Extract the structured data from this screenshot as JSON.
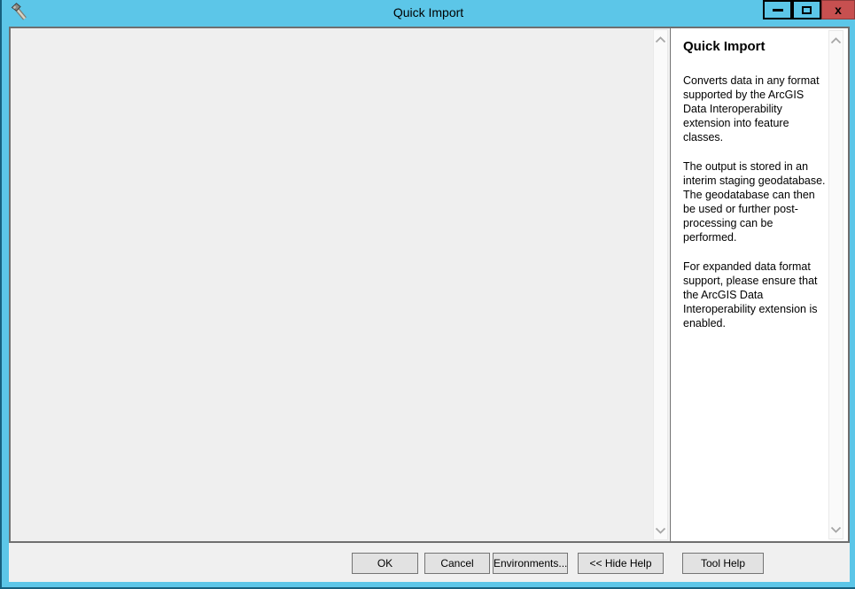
{
  "window": {
    "title": "Quick Import",
    "close_glyph": "x"
  },
  "help": {
    "heading": "Quick Import",
    "paragraphs": [
      "Converts data in any format supported by the ArcGIS Data Interoperability extension into feature classes.",
      "The output is stored in an interim staging geodatabase. The geodatabase can then be used or further post-processing can be performed.",
      "For expanded data format support, please ensure that the ArcGIS Data Interoperability extension is enabled."
    ]
  },
  "footer": {
    "buttons": [
      {
        "label": "OK"
      },
      {
        "label": "Cancel"
      },
      {
        "label": "Environments..."
      },
      {
        "label": "<< Hide Help"
      },
      {
        "label": "Tool Help"
      }
    ]
  },
  "colors": {
    "titlebar_blue": "#5cc6e8",
    "close_red": "#c75050",
    "panel_gray": "#efefef",
    "help_white": "#ffffff",
    "border_gray": "#6f6f6f"
  }
}
